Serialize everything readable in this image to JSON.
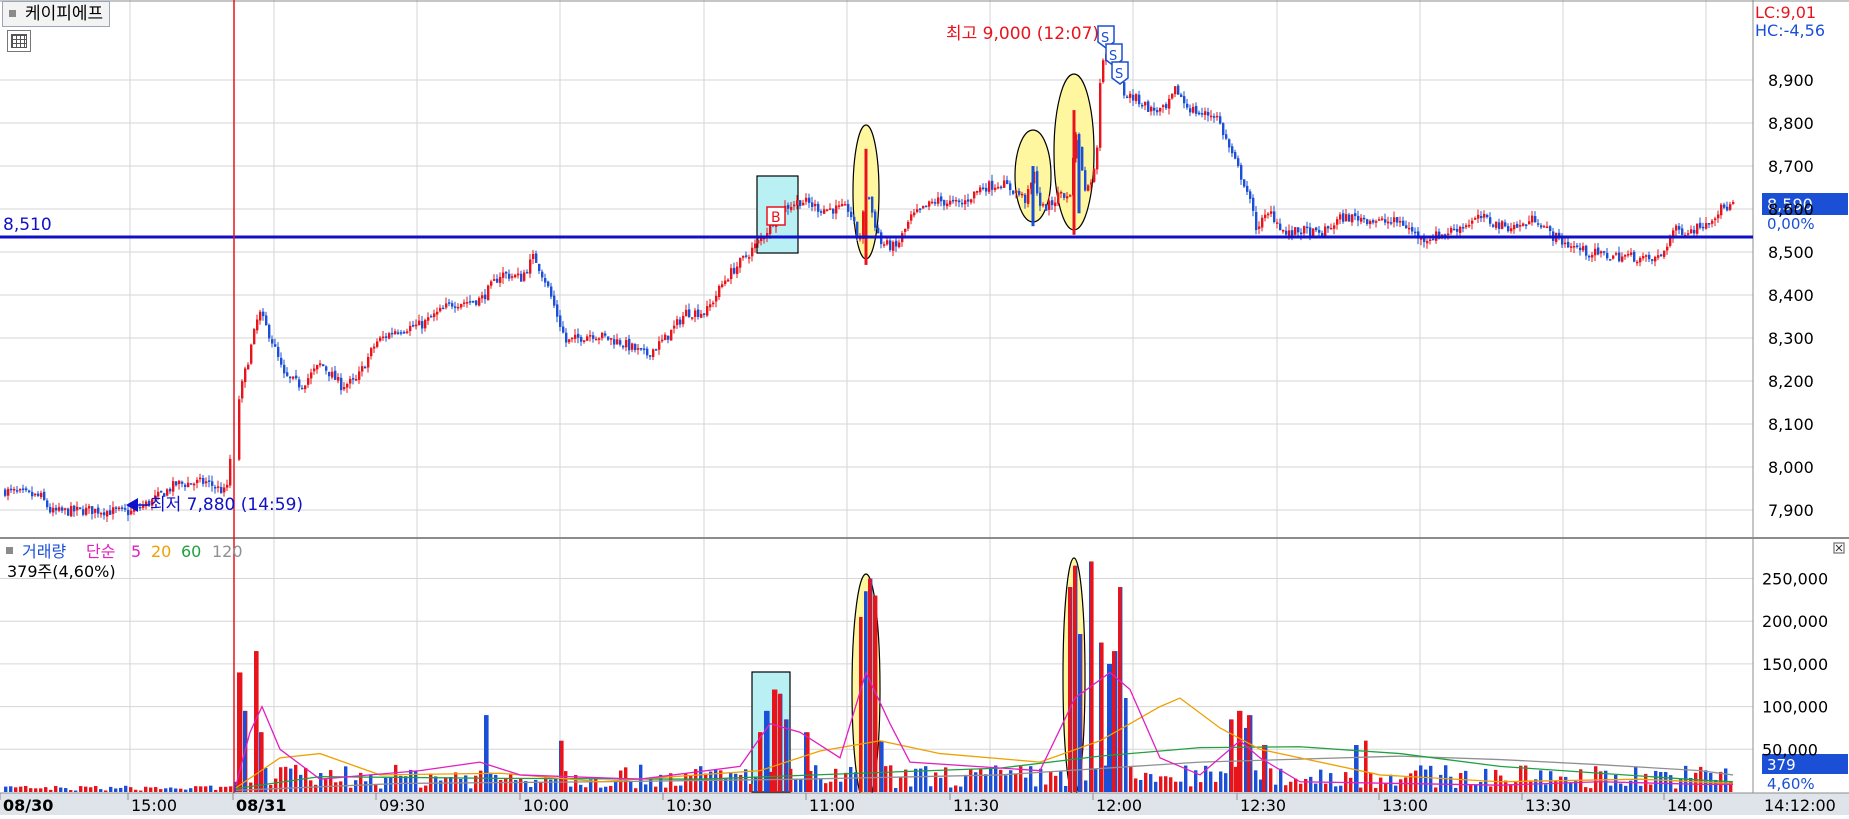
{
  "window": {
    "title": "케이피에프"
  },
  "price_panel": {
    "lc_label": "LC:9,01",
    "hc_label": "HC:-4,56",
    "hline_label": "8,510",
    "current_badge": "8,590",
    "pct_badge": "0,00%",
    "high_annotation": "최고 9,000 (12:07)",
    "low_annotation": "최저 7,880 (14:59)",
    "buy_marker": "B",
    "sell_marker": "S",
    "y_ticks": [
      "7,900",
      "8,000",
      "8,100",
      "8,200",
      "8,300",
      "8,400",
      "8,500",
      "8,600",
      "8,700",
      "8,800",
      "8,900"
    ]
  },
  "volume_panel": {
    "legend_title": "거래량",
    "legend_ma_label": "단순",
    "legend_periods": [
      "5",
      "20",
      "60",
      "120"
    ],
    "info": "379주(4,60%)",
    "current_badge": "379",
    "pct_badge": "4,60%",
    "y_ticks": [
      "50,000",
      "100,000",
      "150,000",
      "200,000",
      "250,000"
    ]
  },
  "x_axis": {
    "labels": [
      "08/30",
      "15:00",
      "08/31",
      "09:30",
      "10:00",
      "10:30",
      "11:00",
      "11:30",
      "12:00",
      "12:30",
      "13:00",
      "13:30",
      "14:00"
    ],
    "current_time": "14:12:00"
  },
  "colors": {
    "up": "#e8141c",
    "down": "#1a4fd6",
    "hline": "#1010c8",
    "vline": "#e8141c",
    "grid": "#d6d6d6",
    "ma5": "#e020c0",
    "ma20": "#f0a000",
    "ma60": "#20a040",
    "ma120": "#909090",
    "highlight_yellow": "#fff6a0",
    "highlight_cyan": "#b8f0f4"
  },
  "chart_data": [
    {
      "type": "candlestick",
      "title": "케이피에프",
      "ylim": [
        7840,
        9040
      ],
      "x": [
        "08/30 14:45",
        "08/30 15:00",
        "08/30 15:20",
        "08/31 09:00",
        "09:15",
        "09:30",
        "09:45",
        "10:00",
        "10:15",
        "10:30",
        "10:45",
        "11:00",
        "11:15",
        "11:30",
        "11:45",
        "12:00",
        "12:15",
        "12:30",
        "12:45",
        "13:00",
        "13:15",
        "13:30",
        "13:45",
        "14:00",
        "14:12"
      ],
      "close": [
        7940,
        7890,
        7950,
        8260,
        8190,
        8290,
        8350,
        8440,
        8300,
        8260,
        8440,
        8600,
        8580,
        8620,
        8650,
        8870,
        8800,
        8600,
        8560,
        8540,
        8570,
        8560,
        8470,
        8540,
        8590
      ],
      "reference_line": 8510,
      "high": {
        "value": 9000,
        "time": "12:07"
      },
      "low": {
        "value": 7880,
        "time": "14:59"
      }
    },
    {
      "type": "bar",
      "title": "거래량",
      "ylim": [
        0,
        270000
      ],
      "x": [
        "08/31 09:00",
        "09:15",
        "09:30",
        "09:45",
        "10:00",
        "10:15",
        "10:30",
        "10:45",
        "11:00",
        "11:15",
        "11:30",
        "11:45",
        "12:00",
        "12:15",
        "12:30",
        "12:45",
        "13:00",
        "13:15",
        "13:30",
        "13:45",
        "14:00"
      ],
      "values": [
        140000,
        30000,
        15000,
        40000,
        55000,
        25000,
        15000,
        120000,
        250000,
        20000,
        40000,
        265000,
        255000,
        100000,
        95000,
        20000,
        10000,
        8000,
        15000,
        8000,
        10000
      ],
      "moving_averages": [
        "5",
        "20",
        "60",
        "120"
      ]
    }
  ]
}
